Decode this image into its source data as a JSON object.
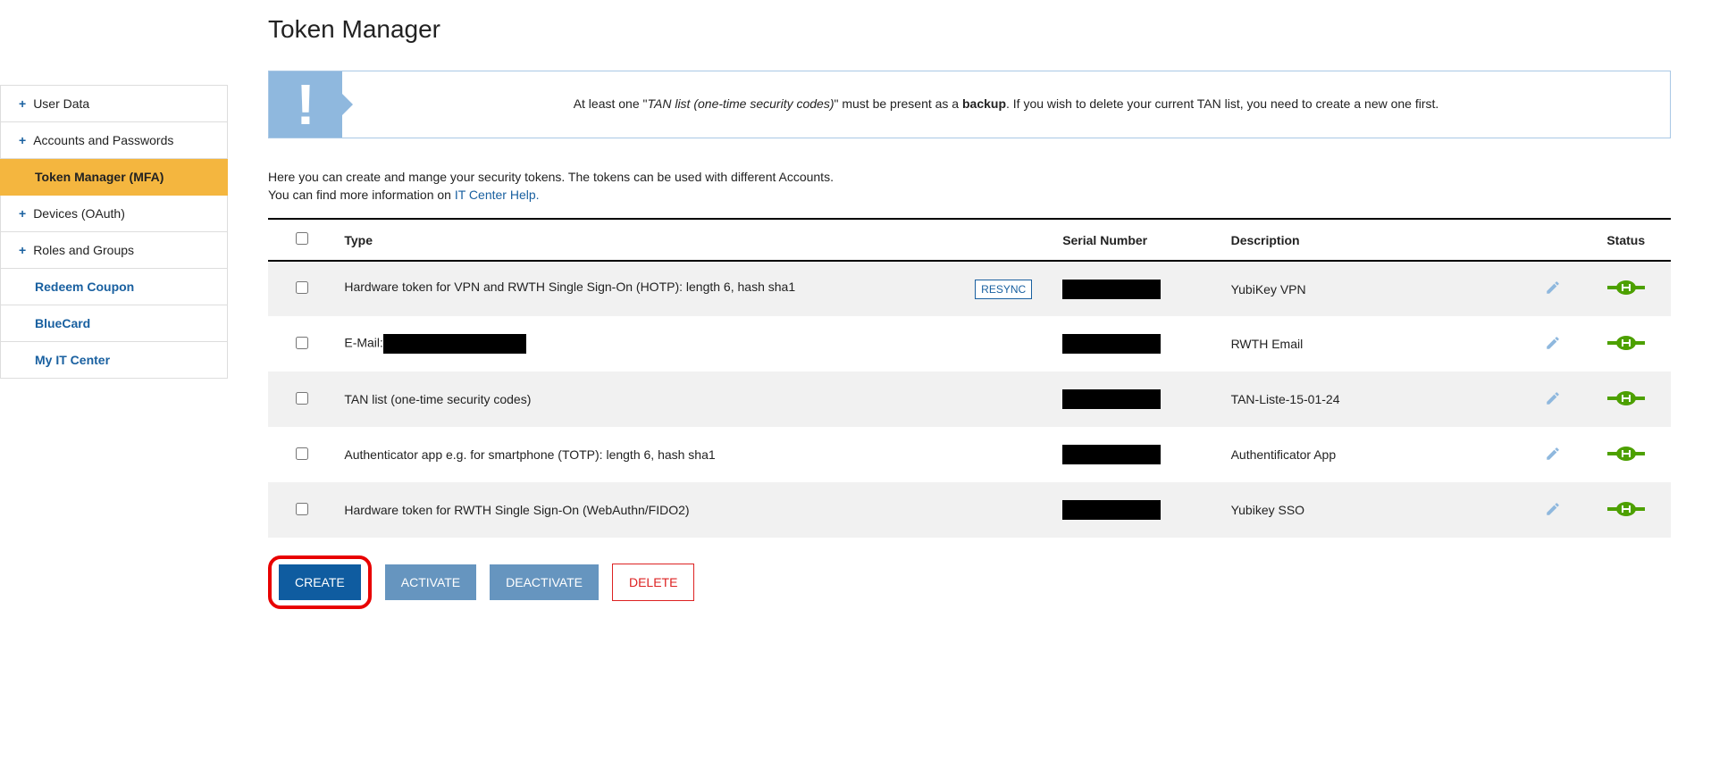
{
  "page": {
    "title": "Token Manager"
  },
  "sidebar": {
    "items": [
      {
        "label": "User Data",
        "expandable": true
      },
      {
        "label": "Accounts and Passwords",
        "expandable": true
      },
      {
        "label": "Token Manager (MFA)",
        "active": true
      },
      {
        "label": "Devices (OAuth)",
        "expandable": true
      },
      {
        "label": "Roles and Groups",
        "expandable": true
      },
      {
        "label": "Redeem Coupon",
        "link": true
      },
      {
        "label": "BlueCard",
        "link": true
      },
      {
        "label": "My IT Center",
        "link": true
      }
    ]
  },
  "notice": {
    "prefix": "At least one \"",
    "emph": "TAN list (one-time security codes)",
    "mid": "\" must be present as a ",
    "bold": "backup",
    "suffix": ". If you wish to delete your current TAN list, you need to create a new one first."
  },
  "intro": {
    "line1": "Here you can create and mange your security tokens. The tokens can be used with different Accounts.",
    "line2_prefix": "You can find more information on ",
    "line2_link": "IT Center Help."
  },
  "table": {
    "headers": {
      "type": "Type",
      "serial": "Serial Number",
      "desc": "Description",
      "status": "Status"
    },
    "rows": [
      {
        "type": "Hardware token for VPN and RWTH Single Sign-On (HOTP): length 6, hash sha1",
        "resync": "RESYNC",
        "desc": "YubiKey VPN"
      },
      {
        "type_prefix": "E-Mail:",
        "desc": "RWTH Email"
      },
      {
        "type": "TAN list (one-time security codes)",
        "desc": "TAN-Liste-15-01-24"
      },
      {
        "type": "Authenticator app e.g. for smartphone (TOTP): length 6, hash sha1",
        "desc": "Authentificator App"
      },
      {
        "type": "Hardware token for RWTH Single Sign-On (WebAuthn/FIDO2)",
        "desc": "Yubikey SSO"
      }
    ]
  },
  "actions": {
    "create": "CREATE",
    "activate": "ACTIVATE",
    "deactivate": "DEACTIVATE",
    "delete": "DELETE"
  }
}
